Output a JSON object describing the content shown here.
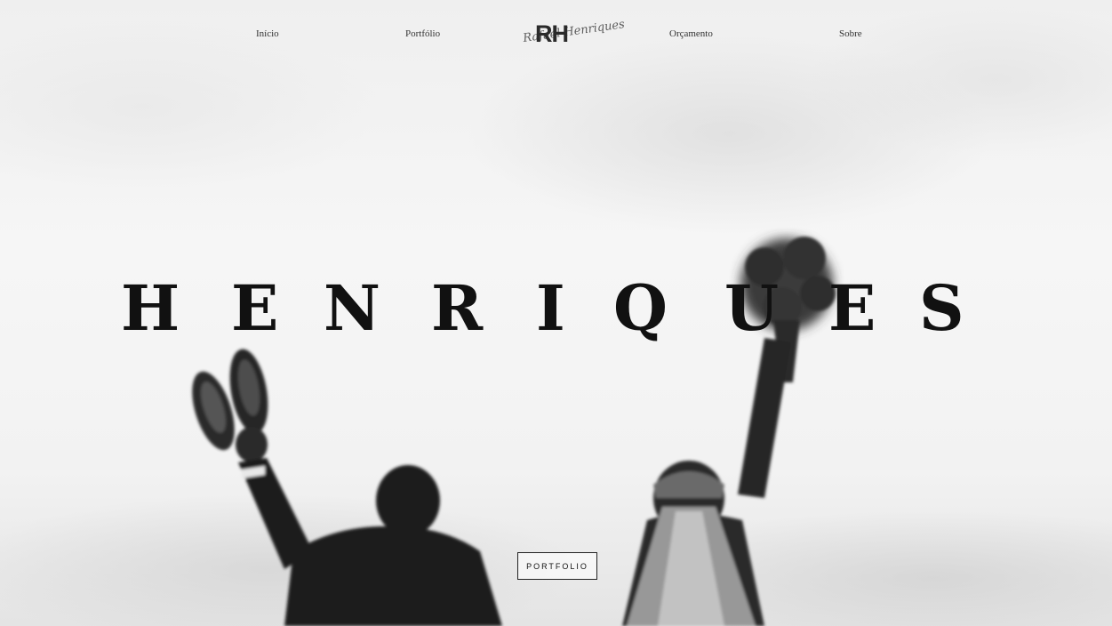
{
  "nav": {
    "items": [
      {
        "label": "Início"
      },
      {
        "label": "Portfólio"
      },
      {
        "label": "Orçamento"
      },
      {
        "label": "Sobre"
      }
    ],
    "logo": {
      "initials": "RH",
      "script": "Rafael Henriques"
    }
  },
  "hero": {
    "letters": [
      "H",
      "E",
      "N",
      "R",
      "I",
      "Q",
      "U",
      "E",
      "S"
    ],
    "cta_label": "PORTFOLIO"
  },
  "colors": {
    "text": "#111111",
    "background": "#f4f4f4"
  }
}
